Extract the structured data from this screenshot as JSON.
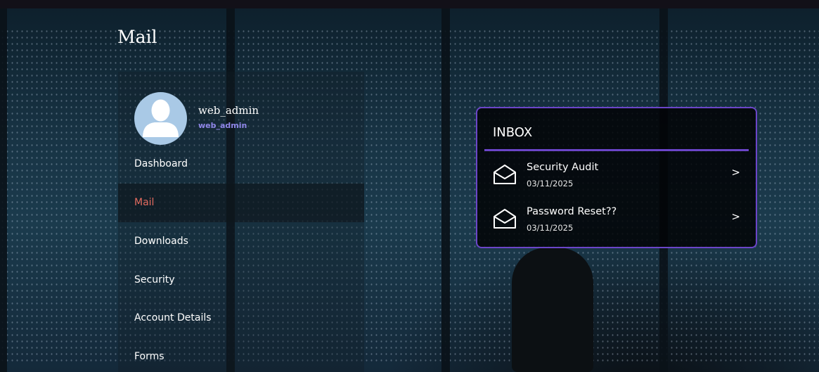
{
  "page": {
    "title": "Mail"
  },
  "user": {
    "name": "web_admin",
    "role": "web_admin"
  },
  "sidebar": {
    "items": [
      {
        "label": "Dashboard",
        "active": false
      },
      {
        "label": "Mail",
        "active": true
      },
      {
        "label": "Downloads",
        "active": false
      },
      {
        "label": "Security",
        "active": false
      },
      {
        "label": "Account Details",
        "active": false
      },
      {
        "label": "Forms",
        "active": false
      }
    ]
  },
  "inbox": {
    "title": "INBOX",
    "messages": [
      {
        "subject": "Security Audit",
        "date": "03/11/2025",
        "icon": "envelope-open-icon",
        "chevron": ">"
      },
      {
        "subject": "Password Reset??",
        "date": "03/11/2025",
        "icon": "envelope-open-icon",
        "chevron": ">"
      }
    ]
  },
  "colors": {
    "accent": "#6b45c9",
    "active_nav": "#e36b5f",
    "role_text": "#8f86e8",
    "avatar_bg": "#a9c9e6"
  }
}
